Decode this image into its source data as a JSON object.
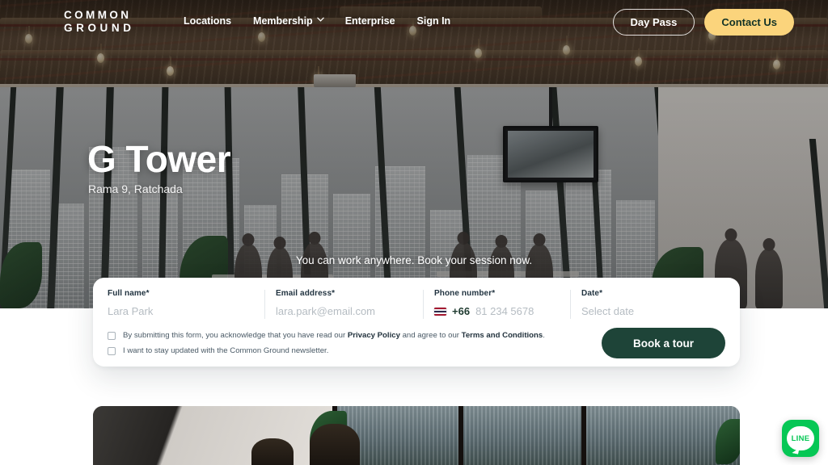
{
  "header": {
    "logo_line1": "COMMON",
    "logo_line2": "GROUND",
    "nav": [
      {
        "label": "Locations",
        "has_chevron": false
      },
      {
        "label": "Membership",
        "has_chevron": true
      },
      {
        "label": "Enterprise",
        "has_chevron": false
      },
      {
        "label": "Sign In",
        "has_chevron": false
      }
    ],
    "day_pass_label": "Day Pass",
    "contact_label": "Contact Us",
    "contact_bg_color": "#FBD47C",
    "contact_text_color": "#123226"
  },
  "hero": {
    "title": "G Tower",
    "subtitle": "Rama 9, Ratchada",
    "tagline": "You can work anywhere. Book your session now."
  },
  "form": {
    "fields": [
      {
        "label": "Full name*",
        "value": "Lara Park"
      },
      {
        "label": "Email address*",
        "value": "lara.park@email.com"
      },
      {
        "label": "Phone number*",
        "dial_code": "+66",
        "value": "81 234 5678",
        "flag": "thailand-flag-icon"
      },
      {
        "label": "Date*",
        "value": "Select date"
      }
    ],
    "consents": [
      {
        "text_before": "By submitting this form, you acknowledge that you have read our ",
        "link1": "Privacy Policy",
        "text_middle": " and agree to our ",
        "link2": "Terms and Conditions",
        "text_after": ".",
        "checked": false
      },
      {
        "text_before": "I want to stay updated with the Common Ground newsletter.",
        "checked": false
      }
    ],
    "submit_label": "Book a tour",
    "submit_bg_color": "#1E4438"
  },
  "chat_widget": {
    "label": "LINE",
    "brand_color": "#06C755"
  }
}
